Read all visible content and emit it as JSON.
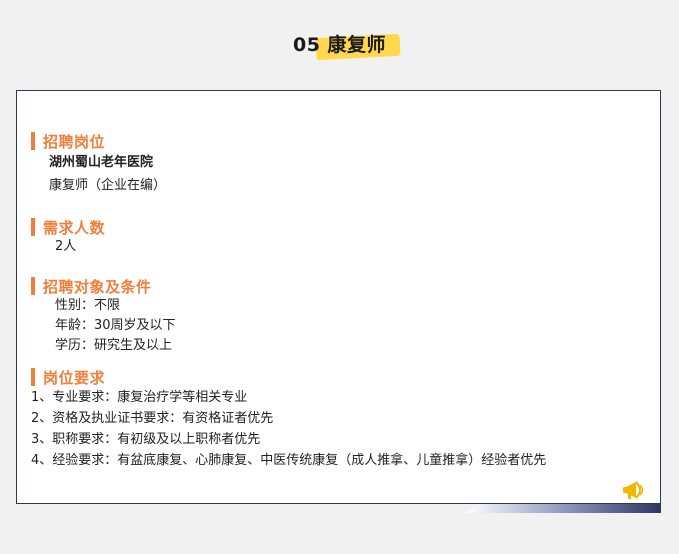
{
  "header": {
    "title": "05 康复师"
  },
  "sections": {
    "position": {
      "title": "招聘岗位",
      "employer": "湖州蜀山老年医院",
      "role": "康复师（企业在编）"
    },
    "headcount": {
      "title": "需求人数",
      "value": "2人"
    },
    "conditions": {
      "title": "招聘对象及条件",
      "items": [
        "性别：不限",
        "年龄：30周岁及以下",
        "学历：研究生及以上"
      ]
    },
    "requirements": {
      "title": "岗位要求",
      "items": [
        "1、专业要求：康复治疗学等相关专业",
        "2、资格及执业证书要求：有资格证者优先",
        "3、职称要求：有初级及以上职称者优先",
        "4、经验要求：有盆底康复、心肺康复、中医传统康复（成人推拿、儿童推拿）经验者优先"
      ]
    }
  },
  "colors": {
    "accent": "#f07f3c",
    "border": "#2d3561",
    "highlight": "#ffd84d",
    "background": "#f1f1f1"
  },
  "icons": {
    "footer": "megaphone-icon"
  }
}
